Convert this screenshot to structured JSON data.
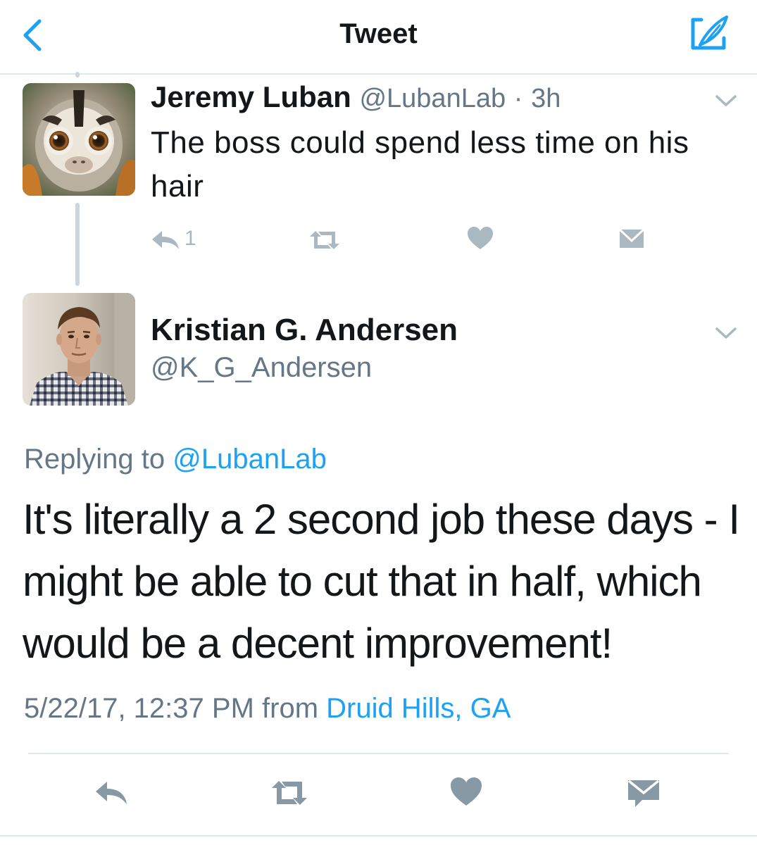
{
  "header": {
    "title": "Tweet",
    "back_icon": "chevron-left-icon",
    "compose_icon": "compose-tweet-icon",
    "accent_color": "#1da1f2"
  },
  "parent_tweet": {
    "author_name": "Jeremy Luban",
    "author_handle": "@LubanLab",
    "separator": "·",
    "time_ago": "3h",
    "text": "The boss could spend less time on his hair",
    "actions": {
      "reply_count": "1"
    }
  },
  "main_tweet": {
    "author_name": "Kristian G. Andersen",
    "author_handle": "@K_G_Andersen",
    "replying_prefix": "Replying to",
    "replying_to": "@LubanLab",
    "text": "It's literally a 2 second job these days - I might be able to cut that in half, which would be a decent improvement!",
    "timestamp": "5/22/17, 12:37 PM",
    "from_label": "from",
    "location": "Druid Hills, GA"
  },
  "colors": {
    "text": "#14171a",
    "muted": "#657786",
    "icon_gray": "#aab8c2",
    "action_gray": "#8899a6",
    "link": "#1da1f2",
    "divider": "#e1e8ed"
  }
}
